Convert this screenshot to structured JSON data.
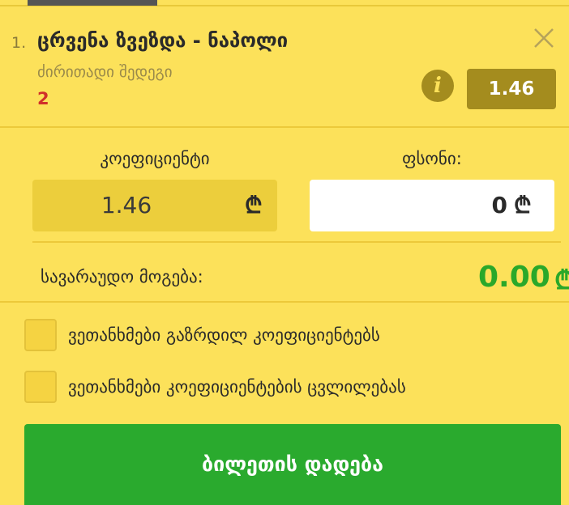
{
  "bet": {
    "index": "1.",
    "title": "ცრვენა ზვეზდა - ნაპოლი",
    "market": "ძირითადი შედეგი",
    "outcome": "2",
    "odds": "1.46"
  },
  "form": {
    "odds_label": "კოეფიციენტი",
    "stake_label": "ფსონი:",
    "odds_value": "1.46",
    "stake_value": "0",
    "currency_symbol": "₾"
  },
  "winnings": {
    "label": "სავარაუდო მოგება:",
    "value": "0.00",
    "currency_symbol": "₾"
  },
  "options": [
    {
      "label": "ვეთანხმები გაზრდილ კოეფიციენტებს",
      "checked": false
    },
    {
      "label": "ვეთანხმები კოეფიციენტების ცვლილებას",
      "checked": false
    }
  ],
  "actions": {
    "place_bet": "ბილეთის დადება"
  },
  "colors": {
    "background": "#fce15a",
    "accent_dark": "#a48c1e",
    "success": "#2aaa2e",
    "outcome_red": "#d0302a"
  },
  "icons": {
    "close": "close-icon",
    "info": "info-icon"
  }
}
